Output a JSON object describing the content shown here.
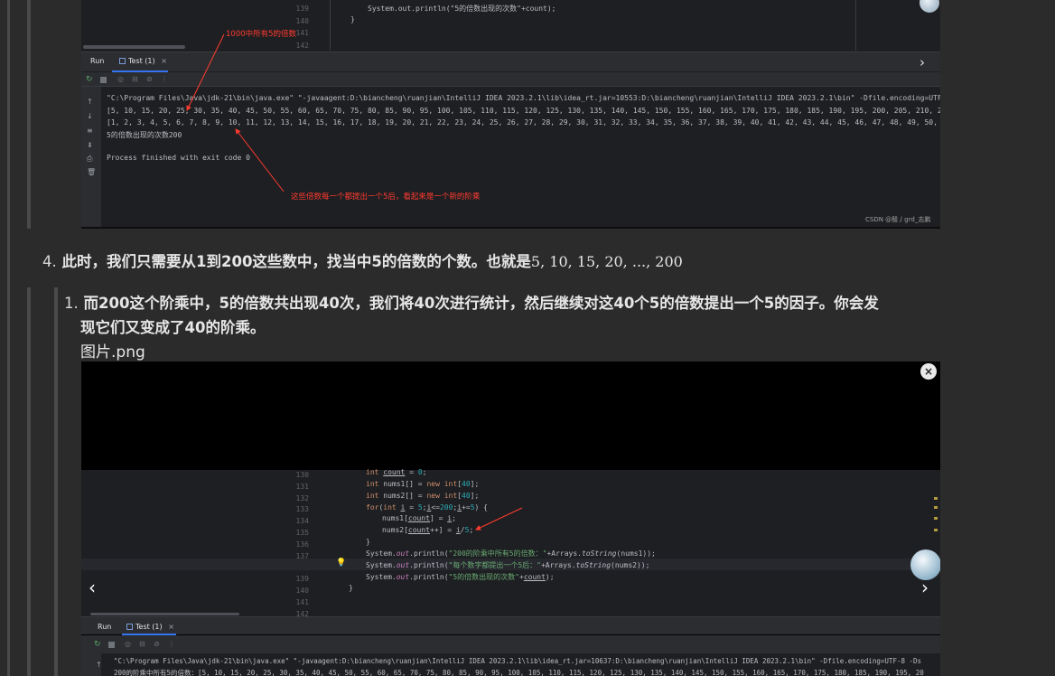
{
  "image1": {
    "line_numbers": [
      "139",
      "140",
      "141",
      "142"
    ],
    "code_line_1": "System.out.println(\"5的倍数出现的次数\"+count);",
    "code_line_2": "}",
    "tab_run": "Run",
    "tab_test": "Test (1)",
    "tab_close": "×",
    "console_lines": [
      "\"C:\\Program Files\\Java\\jdk-21\\bin\\java.exe\" \"-javaagent:D:\\biancheng\\ruanjian\\IntelliJ IDEA 2023.2.1\\lib\\idea_rt.jar=10553:D:\\biancheng\\ruanjian\\IntelliJ IDEA 2023.2.1\\bin\" -Dfile.encoding=UTF-",
      "[5, 10, 15, 20, 25, 30, 35, 40, 45, 50, 55, 60, 65, 70, 75, 80, 85, 90, 95, 100, 105, 110, 115, 120, 125, 130, 135, 140, 145, 150, 155, 160, 165, 170, 175, 180, 185, 190, 195, 200, 205, 210, 2",
      "[1, 2, 3, 4, 5, 6, 7, 8, 9, 10, 11, 12, 13, 14, 15, 16, 17, 18, 19, 20, 21, 22, 23, 24, 25, 26, 27, 28, 29, 30, 31, 32, 33, 34, 35, 36, 37, 38, 39, 40, 41, 42, 43, 44, 45, 46, 47, 48, 49, 50, 5",
      "5的倍数出现的次数200",
      "",
      "Process finished with exit code 0"
    ],
    "annotation_top": "1000中所有5的倍数",
    "annotation_bottom": "这些倍数每一个都提出一个5后，看起来是一个新的阶乘",
    "watermark": "CSDN @殷丿grd_志鹏",
    "accent": "#3574f0",
    "annotation_color": "#ff3b30"
  },
  "item4": {
    "number": "4.",
    "text": "此时，我们只需要从1到200这些数中，找当中5的倍数的个数。也就是",
    "math": "5, 10, 15, 20, ..., 200"
  },
  "item1": {
    "number": "1.",
    "line1": "而200这个阶乘中，5的倍数共出现40次，我们将40次进行统计，然后继续对这40个5的倍数提出一个5的因子。你会发",
    "line2": "现它们又变成了40的阶乘。"
  },
  "caption": "图片.png",
  "image2": {
    "close_icon": "×",
    "nav_prev": "‹",
    "nav_next": "›",
    "line_numbers": [
      "130",
      "131",
      "132",
      "133",
      "134",
      "135",
      "136",
      "137",
      "138",
      "139",
      "140",
      "141",
      "142"
    ],
    "tab_run": "Run",
    "tab_test": "Test (1)",
    "tab_close": "×",
    "console_lines": [
      "\"C:\\Program Files\\Java\\jdk-21\\bin\\java.exe\" \"-javaagent:D:\\biancheng\\ruanjian\\IntelliJ IDEA 2023.2.1\\lib\\idea_rt.jar=10637:D:\\biancheng\\ruanjian\\IntelliJ IDEA 2023.2.1\\bin\" -Dfile.encoding=UTF-8 -Ds",
      "200的阶乘中所有5的倍数：[5, 10, 15, 20, 25, 30, 35, 40, 45, 50, 55, 60, 65, 70, 75, 80, 85, 90, 95, 100, 105, 110, 115, 120, 125, 130, 135, 140, 145, 150, 155, 160, 165, 170, 175, 180, 185, 190, 195, 20"
    ]
  }
}
